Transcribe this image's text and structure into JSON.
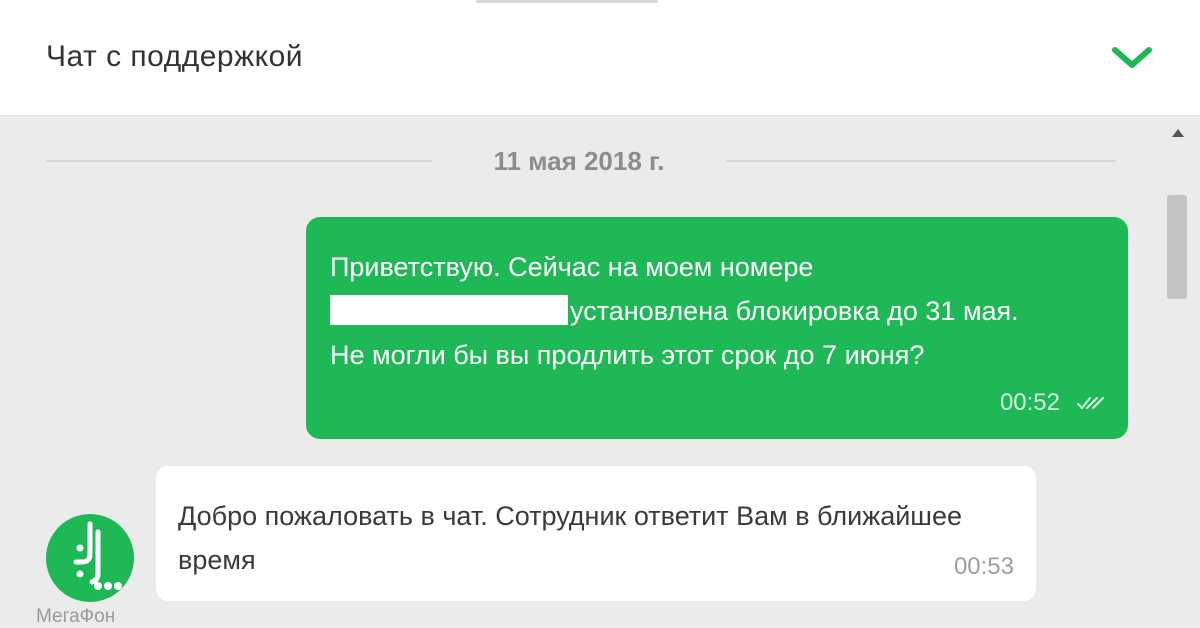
{
  "header": {
    "title": "Чат с поддержкой",
    "collapse_icon": "chevron-down-icon",
    "accent_color": "#1fb856"
  },
  "chat": {
    "date": "11 мая 2018 г.",
    "messages": [
      {
        "direction": "outgoing",
        "line1": "Приветствую. Сейчас на моем номере",
        "line2": "установлена блокировка до 31 мая.",
        "line3": "Не могли бы вы продлить этот срок до 7 июня?",
        "time": "00:52",
        "status_icon": "double-check-icon",
        "bubble_color": "#1fb856"
      },
      {
        "direction": "incoming",
        "text": "Добро пожаловать в чат. Сотрудник ответит Вам в ближайшее время",
        "time": "00:53",
        "sender_caption": "МегаФон",
        "avatar_icon": "megafon-logo-icon"
      }
    ]
  },
  "scrollbar": {
    "up_icon": "scroll-up-arrow-icon"
  }
}
